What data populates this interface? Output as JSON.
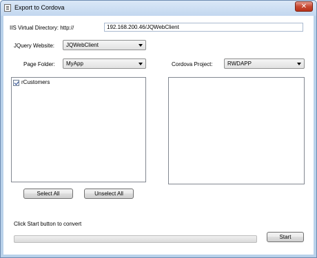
{
  "window": {
    "title": "Export to Cordova",
    "close_glyph": "✕"
  },
  "iis": {
    "label": "IIS Virtual Directory:  http://",
    "value": "192.168.200.46/JQWebClient"
  },
  "jquery_website": {
    "label": "JQuery Website:",
    "selected": "JQWebClient"
  },
  "page_folder": {
    "label": "Page Folder:",
    "selected": "MyApp"
  },
  "cordova_project": {
    "label": "Cordova Project:",
    "selected": "RWDAPP"
  },
  "pages_list": {
    "items": [
      {
        "label": "rCustomers",
        "checked": true
      }
    ]
  },
  "buttons": {
    "select_all": "Select All",
    "unselect_all": "Unselect All",
    "start": "Start"
  },
  "status": {
    "text": "Click Start button to convert",
    "progress": 0
  }
}
